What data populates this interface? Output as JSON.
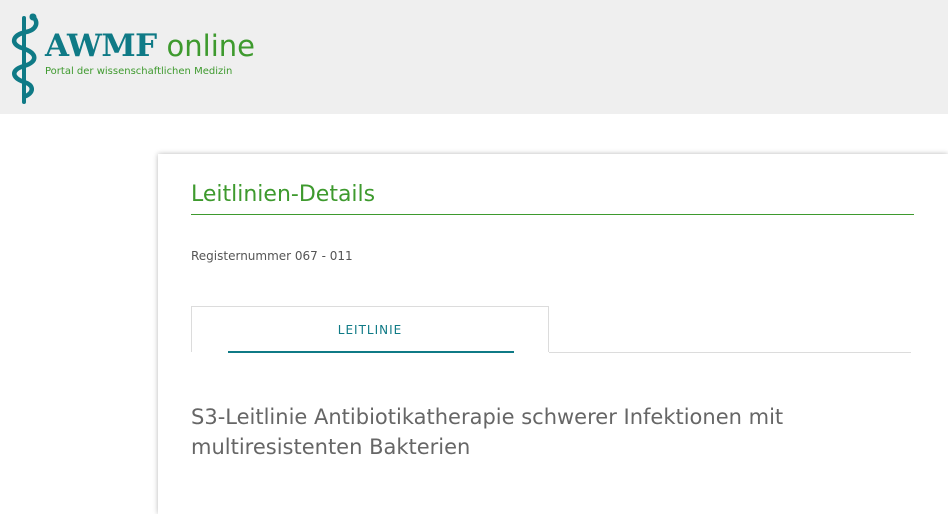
{
  "header": {
    "logo_brand": "AWMF",
    "logo_suffix": "online",
    "logo_tagline": "Portal der wissenschaftlichen Medizin",
    "logo_icon": "staff-of-asclepius-icon"
  },
  "details": {
    "section_title": "Leitlinien-Details",
    "register_number": "Registernummer 067 - 011",
    "tabs": [
      {
        "label": "LEITLINIE",
        "active": true
      }
    ],
    "guideline_title": "S3-Leitlinie Antibiotikatherapie schwerer Infektionen mit multiresistenten Bakterien"
  },
  "colors": {
    "brand_teal": "#0f7a86",
    "brand_green": "#3e9a2e",
    "header_bg": "#efefef",
    "text_gray": "#666666"
  }
}
